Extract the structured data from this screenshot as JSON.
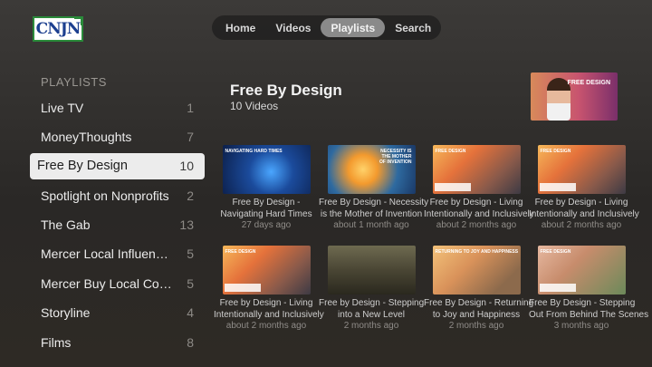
{
  "logo": {
    "text": "CNJN"
  },
  "nav": {
    "tabs": [
      "Home",
      "Videos",
      "Playlists",
      "Search"
    ],
    "active": "Playlists"
  },
  "sidebar": {
    "heading": "PLAYLISTS",
    "items": [
      {
        "label": "Live TV",
        "count": "1"
      },
      {
        "label": "MoneyThoughts",
        "count": "7"
      },
      {
        "label": "Free By Design",
        "count": "10",
        "selected": true
      },
      {
        "label": "Spotlight on Nonprofits",
        "count": "2"
      },
      {
        "label": "The Gab",
        "count": "13"
      },
      {
        "label": "Mercer Local Influence...",
        "count": "5"
      },
      {
        "label": "Mercer Buy Local Con...",
        "count": "5"
      },
      {
        "label": "Storyline",
        "count": "4"
      },
      {
        "label": "Films",
        "count": "8"
      }
    ]
  },
  "playlist": {
    "title": "Free By Design",
    "subtitle": "10 Videos",
    "hero_text": "FREE DESIGN"
  },
  "videos": [
    {
      "line1": "Free By Design -",
      "line2": "Navigating Hard Times",
      "date": "27 days ago",
      "thumb": "t-blue",
      "tag": "NAVIGATING HARD TIMES"
    },
    {
      "line1": "Free By Design - Necessity",
      "line2": "is the Mother of Invention",
      "date": "about 1 month ago",
      "thumb": "t-bulb",
      "tag": "NECESSITY IS THE MOTHER OF INVENTION"
    },
    {
      "line1": "Free by Design - Living",
      "line2": "Intentionally and Inclusively",
      "date": "about 2 months ago",
      "thumb": "t-warm",
      "tag": "FREE DESIGN"
    },
    {
      "line1": "Free by Design - Living",
      "line2": "Intentionally and Inclusively",
      "date": "about 2 months ago",
      "thumb": "t-warm",
      "tag": "FREE DESIGN"
    },
    {
      "line1": "Free by Design - Living",
      "line2": "Intentionally and Inclusively",
      "date": "about 2 months ago",
      "thumb": "t-warm",
      "tag": "FREE DESIGN"
    },
    {
      "line1": "Free by Design - Stepping",
      "line2": "into a New Level",
      "date": "2 months ago",
      "thumb": "t-stairs",
      "tag": ""
    },
    {
      "line1": "Free By Design - Returning",
      "line2": "to Joy and Happiness",
      "date": "2 months ago",
      "thumb": "t-car",
      "tag": "RETURNING TO JOY AND HAPPINESS"
    },
    {
      "line1": "Free By Design - Stepping",
      "line2": "Out From Behind The Scenes",
      "date": "3 months ago",
      "thumb": "t-step",
      "tag": "FREE DESIGN"
    }
  ]
}
